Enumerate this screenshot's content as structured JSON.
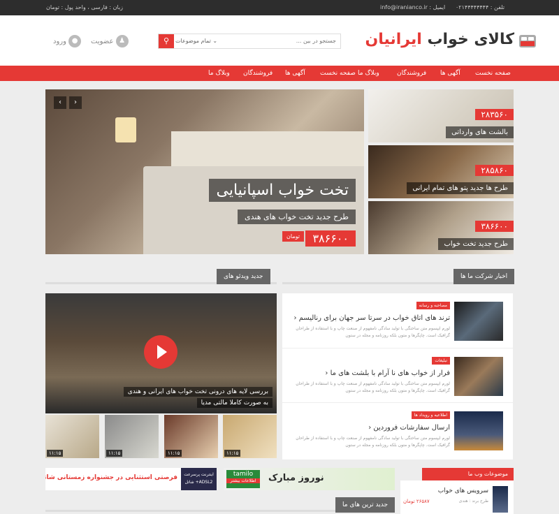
{
  "topbar": {
    "lang": "زبان : فارسی",
    "currency": "واحد پول : تومان",
    "email": "info@iranianco.ir : ایمیل",
    "phone": "۰۲۱۴۴۴۴۴۴۴۴ : تلفن"
  },
  "header": {
    "logo_part1": "کالای خواب",
    "logo_part2": "ایرانیان",
    "search_placeholder": "جستجو در بین ...",
    "search_category": "تمام موضوعات",
    "membership": "عضویت",
    "login": "ورود"
  },
  "nav": {
    "items": [
      "صفحه نخست",
      "آگهی ها",
      "فروشندگان",
      "وبلاگ ما",
      "صفحه نخست",
      "آگهی ها",
      "فروشندگان",
      "وبلاگ ما"
    ]
  },
  "slider": {
    "title": "تخت خواب اسپانیایی",
    "subtitle": "طرح جدید تخت خواب های هندی",
    "price": "۳۸۶۶۰۰",
    "currency": "تومان"
  },
  "side_cards": [
    {
      "price": "۲۸۳۵۶۰",
      "label": "بالشت های وارداتی"
    },
    {
      "price": "۲۸۵۸۶۰",
      "label": "طرح ها جدید پتو های تمام ایرانی"
    },
    {
      "price": "۳۸۶۶۰۰",
      "label": "طرح جدید تخت خواب"
    }
  ],
  "sections": {
    "videos": "جدید ویدئو های",
    "news": "اخبار شرکت ما ها",
    "topics": "موضوعات وب ما",
    "newest": "جدید ترین های ما"
  },
  "video": {
    "caption1": "بررسی لایه های درونی تخت خواب های ایرانی و هندی",
    "caption2": "به صورت کاملا مالتی مدیا",
    "thumbs": [
      "۱۱:۱۵",
      "۱۱:۱۵",
      "۱۱:۱۵",
      "۱۱:۱۵"
    ]
  },
  "news": [
    {
      "badge": "مصاحبه و رسانه",
      "title": "ترند های اتاق خواب در سرتا سر جهان برای رناليسم",
      "text": "لورم ایپسوم متن ساختگی با تولید سادگی نامفهوم از صنعت چاپ و با استفاده از طراحان گرافیک است. چاپگرها و متون بلکه روزنامه و مجله در ستون"
    },
    {
      "badge": "تبلیغات",
      "title": "فرار از خواب های نا آرام با بلشت های ما",
      "text": "لورم ایپسوم متن ساختگی با تولید سادگی نامفهوم از صنعت چاپ و با استفاده از طراحان گرافیک است. چاپگرها و متون بلکه روزنامه و مجله در ستون"
    },
    {
      "badge": "اطلاعیه و رویداد ها",
      "title": "ارسال سفارشات فروردین",
      "text": "لورم ایپسوم متن ساختگی با تولید سادگی نامفهوم از صنعت چاپ و با استفاده از طراحان گرافیک است. چاپگرها و متون بلکه روزنامه و مجله در ستون"
    }
  ],
  "banners": {
    "left_text": "فرصتی استثنایی در جشنواره زمستانی شاتل",
    "left_sub": "اینترنت پرسرعت ADSL2+ شاتل",
    "right_text": "نوروز مبارک",
    "right_brand": "tamilo",
    "right_sub": "اطلاعات بیشتر"
  },
  "topic": {
    "title": "سرویس های خواب",
    "meta": "طرح برند : هندی",
    "price": "۲۶۵۸۷ تومان"
  }
}
